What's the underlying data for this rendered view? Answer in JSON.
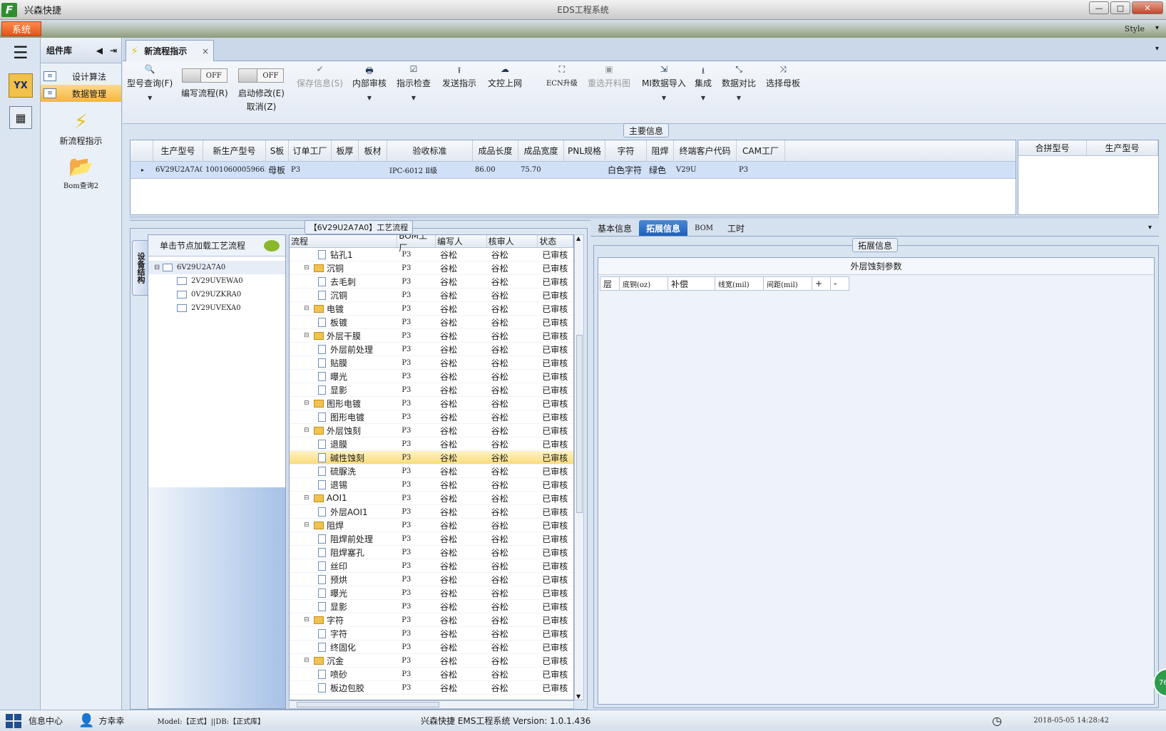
{
  "titlebar": {
    "app_name": "兴森快捷",
    "window_title": "EDS工程系统",
    "minimize": "—",
    "maximize": "□",
    "close": "✕"
  },
  "menubar": {
    "system_button": "系统",
    "style_label": "Style",
    "style_caret": "▾"
  },
  "leftbar": {
    "yx_label": "YX"
  },
  "component_library": {
    "title": "组件库",
    "nav_back": "◀",
    "nav_pin": "⇥",
    "items": [
      {
        "label": "设计算法",
        "active": false
      },
      {
        "label": "数据管理",
        "active": true
      }
    ],
    "big_items": [
      {
        "icon": "lightning-icon",
        "label": "新流程指示"
      },
      {
        "icon": "folder-icon",
        "label": "Bom查询2"
      }
    ]
  },
  "document_tabs": {
    "active_tab": "新流程指示",
    "close": "×",
    "dropdown": "▾"
  },
  "toolbar": {
    "buttons": [
      {
        "id": "model-query",
        "label": "型号查询(F)",
        "icon": "🔍",
        "caret": true,
        "disabled": false
      },
      {
        "id": "edit-flow",
        "label": "编写流程(R)",
        "toggle": "OFF"
      },
      {
        "id": "enable-modify",
        "label": "启动修改(E)",
        "label2": "取消(Z)",
        "toggle": "OFF"
      },
      {
        "id": "save-info",
        "label": "保存信息(S)",
        "icon": "✔",
        "disabled": true
      },
      {
        "id": "internal-review",
        "label": "内部审核",
        "icon": "🖶",
        "caret": true
      },
      {
        "id": "instruction-check",
        "label": "指示检查",
        "icon": "☑",
        "caret": true
      },
      {
        "id": "send-instruction",
        "label": "发送指示",
        "icon": "⭱"
      },
      {
        "id": "doc-upload",
        "label": "文控上网",
        "icon": "☁"
      },
      {
        "id": "ecn-upgrade",
        "label": "ECN升级",
        "icon": "⛶"
      },
      {
        "id": "reselect-image",
        "label": "重选开料图",
        "icon": "▣",
        "disabled": true
      },
      {
        "id": "mi-import",
        "label": "MI数据导入",
        "icon": "⇲",
        "caret": true
      },
      {
        "id": "integrate",
        "label": "集成",
        "icon": "⭳",
        "caret": true
      },
      {
        "id": "data-compare",
        "label": "数据对比",
        "icon": "⤡",
        "caret": true
      },
      {
        "id": "select-mother",
        "label": "选择母板",
        "icon": "⤨"
      }
    ]
  },
  "main_info": {
    "section_label": "主要信息",
    "columns": [
      "生产型号",
      "新生产型号",
      "S板",
      "订单工厂",
      "板厚",
      "板材",
      "验收标准",
      "成品长度",
      "成品宽度",
      "PNL规格",
      "字符",
      "阻焊",
      "终端客户代码",
      "CAM工厂"
    ],
    "rows": [
      [
        "6V29U2A7A0",
        "10010600059665",
        "母板",
        "P3",
        "",
        "",
        "IPC-6012 Ⅱ级",
        "86.00",
        "75.70",
        "",
        "白色字符",
        "绿色",
        "V29U",
        "P3"
      ]
    ],
    "row_marker": "▸",
    "side_columns": [
      "合拼型号",
      "生产型号"
    ]
  },
  "process": {
    "section_label": "【6V29U2A7A0】工艺流程",
    "vertical_tab": "设备结构",
    "struct_header": "单击节点加载工艺流程",
    "tree": {
      "root": "6V29U2A7A0",
      "children": [
        "2V29UVEWA0",
        "0V29UZKRA0",
        "2V29UVEXA0"
      ]
    },
    "flow_columns": [
      "流程",
      "BOM工厂",
      "编写人",
      "核审人",
      "状态"
    ],
    "flow_rows": [
      {
        "level": 1,
        "name": "钻孔1",
        "factory": "P3",
        "writer": "谷松",
        "reviewer": "谷松",
        "status": "已审核"
      },
      {
        "level": 0,
        "name": "沉铜",
        "factory": "P3",
        "writer": "谷松",
        "reviewer": "谷松",
        "status": "已审核"
      },
      {
        "level": 1,
        "name": "去毛刺",
        "factory": "P3",
        "writer": "谷松",
        "reviewer": "谷松",
        "status": "已审核"
      },
      {
        "level": 1,
        "name": "沉铜",
        "factory": "P3",
        "writer": "谷松",
        "reviewer": "谷松",
        "status": "已审核"
      },
      {
        "level": 0,
        "name": "电镀",
        "factory": "P3",
        "writer": "谷松",
        "reviewer": "谷松",
        "status": "已审核"
      },
      {
        "level": 1,
        "name": "板镀",
        "factory": "P3",
        "writer": "谷松",
        "reviewer": "谷松",
        "status": "已审核"
      },
      {
        "level": 0,
        "name": "外层干膜",
        "factory": "P3",
        "writer": "谷松",
        "reviewer": "谷松",
        "status": "已审核"
      },
      {
        "level": 1,
        "name": "外层前处理",
        "factory": "P3",
        "writer": "谷松",
        "reviewer": "谷松",
        "status": "已审核"
      },
      {
        "level": 1,
        "name": "贴膜",
        "factory": "P3",
        "writer": "谷松",
        "reviewer": "谷松",
        "status": "已审核"
      },
      {
        "level": 1,
        "name": "曝光",
        "factory": "P3",
        "writer": "谷松",
        "reviewer": "谷松",
        "status": "已审核"
      },
      {
        "level": 1,
        "name": "显影",
        "factory": "P3",
        "writer": "谷松",
        "reviewer": "谷松",
        "status": "已审核"
      },
      {
        "level": 0,
        "name": "图形电镀",
        "factory": "P3",
        "writer": "谷松",
        "reviewer": "谷松",
        "status": "已审核"
      },
      {
        "level": 1,
        "name": "图形电镀",
        "factory": "P3",
        "writer": "谷松",
        "reviewer": "谷松",
        "status": "已审核"
      },
      {
        "level": 0,
        "name": "外层蚀刻",
        "factory": "P3",
        "writer": "谷松",
        "reviewer": "谷松",
        "status": "已审核"
      },
      {
        "level": 1,
        "name": "退膜",
        "factory": "P3",
        "writer": "谷松",
        "reviewer": "谷松",
        "status": "已审核"
      },
      {
        "level": 1,
        "name": "碱性蚀刻",
        "factory": "P3",
        "writer": "谷松",
        "reviewer": "谷松",
        "status": "已审核",
        "selected": true
      },
      {
        "level": 1,
        "name": "硫脲洗",
        "factory": "P3",
        "writer": "谷松",
        "reviewer": "谷松",
        "status": "已审核"
      },
      {
        "level": 1,
        "name": "退锡",
        "factory": "P3",
        "writer": "谷松",
        "reviewer": "谷松",
        "status": "已审核"
      },
      {
        "level": 0,
        "name": "AOI1",
        "factory": "P3",
        "writer": "谷松",
        "reviewer": "谷松",
        "status": "已审核"
      },
      {
        "level": 1,
        "name": "外层AOI1",
        "factory": "P3",
        "writer": "谷松",
        "reviewer": "谷松",
        "status": "已审核"
      },
      {
        "level": 0,
        "name": "阻焊",
        "factory": "P3",
        "writer": "谷松",
        "reviewer": "谷松",
        "status": "已审核"
      },
      {
        "level": 1,
        "name": "阻焊前处理",
        "factory": "P3",
        "writer": "谷松",
        "reviewer": "谷松",
        "status": "已审核"
      },
      {
        "level": 1,
        "name": "阻焊塞孔",
        "factory": "P3",
        "writer": "谷松",
        "reviewer": "谷松",
        "status": "已审核"
      },
      {
        "level": 1,
        "name": "丝印",
        "factory": "P3",
        "writer": "谷松",
        "reviewer": "谷松",
        "status": "已审核"
      },
      {
        "level": 1,
        "name": "预烘",
        "factory": "P3",
        "writer": "谷松",
        "reviewer": "谷松",
        "status": "已审核"
      },
      {
        "level": 1,
        "name": "曝光",
        "factory": "P3",
        "writer": "谷松",
        "reviewer": "谷松",
        "status": "已审核"
      },
      {
        "level": 1,
        "name": "显影",
        "factory": "P3",
        "writer": "谷松",
        "reviewer": "谷松",
        "status": "已审核"
      },
      {
        "level": 0,
        "name": "字符",
        "factory": "P3",
        "writer": "谷松",
        "reviewer": "谷松",
        "status": "已审核"
      },
      {
        "level": 1,
        "name": "字符",
        "factory": "P3",
        "writer": "谷松",
        "reviewer": "谷松",
        "status": "已审核"
      },
      {
        "level": 1,
        "name": "终固化",
        "factory": "P3",
        "writer": "谷松",
        "reviewer": "谷松",
        "status": "已审核"
      },
      {
        "level": 0,
        "name": "沉金",
        "factory": "P3",
        "writer": "谷松",
        "reviewer": "谷松",
        "status": "已审核"
      },
      {
        "level": 1,
        "name": "喷砂",
        "factory": "P3",
        "writer": "谷松",
        "reviewer": "谷松",
        "status": "已审核"
      },
      {
        "level": 1,
        "name": "板边包胶",
        "factory": "P3",
        "writer": "谷松",
        "reviewer": "谷松",
        "status": "已审核"
      }
    ]
  },
  "right_panel": {
    "tabs": [
      {
        "label": "基本信息",
        "active": false
      },
      {
        "label": "拓展信息",
        "active": true
      },
      {
        "label": "BOM",
        "active": false
      },
      {
        "label": "工时",
        "active": false
      }
    ],
    "dropdown": "▾",
    "section_label": "拓展信息",
    "box_title": "外层蚀刻参数",
    "columns": [
      "层",
      "底铜(oz)",
      "补偿",
      "线宽(mil)",
      "间距(mil)",
      "+",
      "-"
    ]
  },
  "badge": {
    "text": "76"
  },
  "statusbar": {
    "info_center": "信息中心",
    "user": "方幸幸",
    "model_text": "Model:【正式】||DB:【正式库】",
    "version_text": "兴森快捷 EMS工程系统 Version: 1.0.1.436",
    "datetime": "2018-05-05 14:28:42"
  }
}
